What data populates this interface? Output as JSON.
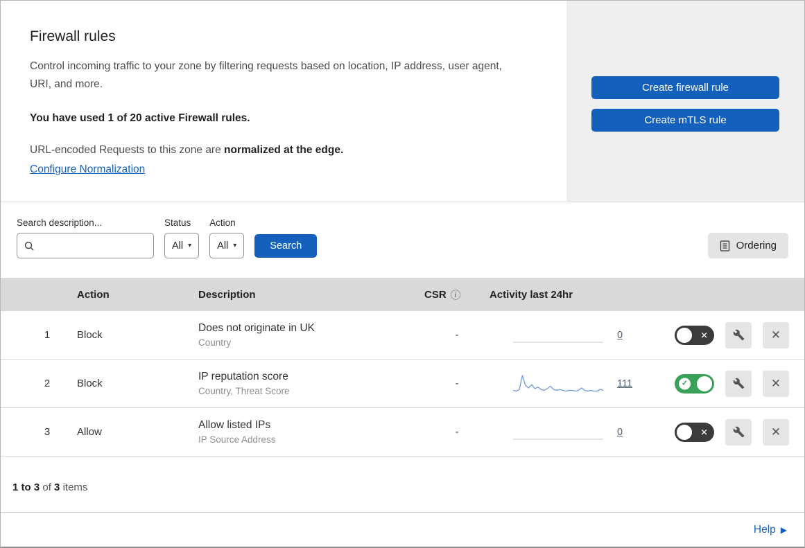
{
  "header": {
    "title": "Firewall rules",
    "description": "Control incoming traffic to your zone by filtering requests based on location, IP address, user agent, URI, and more.",
    "usage_bold": "You have used 1 of 20 active Firewall rules.",
    "normalization_prefix": "URL-encoded Requests to this zone are ",
    "normalization_bold": "normalized at the edge.",
    "normalization_link": "Configure Normalization",
    "create_firewall_label": "Create firewall rule",
    "create_mtls_label": "Create mTLS rule"
  },
  "filters": {
    "search_label": "Search description...",
    "status_label": "Status",
    "status_value": "All",
    "action_label": "Action",
    "action_value": "All",
    "search_button_label": "Search",
    "ordering_button_label": "Ordering"
  },
  "table": {
    "headers": {
      "action": "Action",
      "description": "Description",
      "csr": "CSR",
      "activity": "Activity last 24hr"
    },
    "rows": [
      {
        "number": "1",
        "action": "Block",
        "description": "Does not originate in UK",
        "criteria": "Country",
        "csr": "-",
        "activity_count": "0",
        "enabled": false,
        "sparkline": []
      },
      {
        "number": "2",
        "action": "Block",
        "description": "IP reputation score",
        "criteria": "Country, Threat Score",
        "csr": "-",
        "activity_count": "111",
        "enabled": true,
        "sparkline": [
          3,
          2,
          4,
          21,
          9,
          6,
          10,
          5,
          7,
          4,
          3,
          5,
          8,
          4,
          3,
          4,
          3,
          2,
          3,
          3,
          2,
          3,
          6,
          3,
          2,
          3,
          2,
          2,
          4,
          3
        ]
      },
      {
        "number": "3",
        "action": "Allow",
        "description": "Allow listed IPs",
        "criteria": "IP Source Address",
        "csr": "-",
        "activity_count": "0",
        "enabled": false,
        "sparkline": []
      }
    ]
  },
  "footer": {
    "range": "1 to 3",
    "of": "of",
    "total": "3",
    "items": "items",
    "help_label": "Help"
  },
  "icons": {
    "caret_down": "▾",
    "info": "ⓘ",
    "toggle_check": "✓",
    "toggle_x": "✕",
    "close_x": "✕",
    "help_arrow": "▶"
  },
  "colors": {
    "accent_blue": "#1560bd",
    "toggle_on_green": "#3aa159",
    "toggle_off_gray": "#3b3b3b",
    "panel_gray": "#efefef",
    "table_header_gray": "#d9d9d9",
    "sparkline_blue": "#7d9fd4"
  }
}
